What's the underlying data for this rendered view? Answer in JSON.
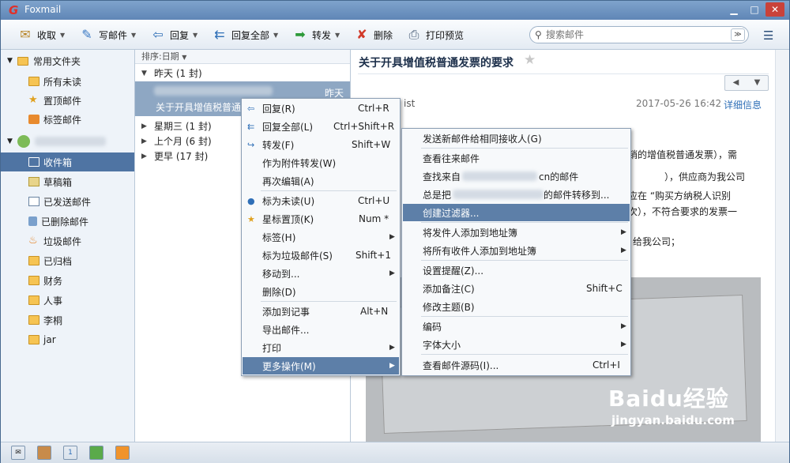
{
  "app": {
    "title": "Foxmail",
    "logo": "G"
  },
  "toolbar": {
    "receive": "收取",
    "compose": "写邮件",
    "reply": "回复",
    "reply_all": "回复全部",
    "forward": "转发",
    "delete": "删除",
    "print_preview": "打印预览",
    "search_placeholder": "搜索邮件"
  },
  "sidebar": {
    "group1": "常用文件夹",
    "fav": [
      "所有未读",
      "置顶邮件",
      "标签邮件"
    ],
    "account_folders": [
      "收件箱",
      "草稿箱",
      "已发送邮件",
      "已删除邮件",
      "垃圾邮件",
      "已归档",
      "财务",
      "人事",
      "李桐",
      "jar"
    ]
  },
  "list": {
    "sort": "排序:日期",
    "groups": [
      "昨天 (1 封)",
      "星期三 (1 封)",
      "上个月 (6 封)",
      "更早 (17 封)"
    ],
    "msg_time": "昨天",
    "msg_subject": "关于开具增值税普通发"
  },
  "reader": {
    "subject": "关于开具增值税普通发票的要求",
    "sender_fragment": "ist",
    "date": "2017-05-26 16:42",
    "detail_link": "详细信息",
    "body_lines": [
      "销的增值税普通发票），需",
      "），供应商为我公司",
      "应在 “购买方纳税人识别",
      "次），不符合要求的发票一",
      "给我公司；"
    ]
  },
  "context_menu": [
    {
      "label": "回复(R)",
      "shortcut": "Ctrl+R",
      "icon": "reply-icon"
    },
    {
      "label": "回复全部(L)",
      "shortcut": "Ctrl+Shift+R",
      "icon": "reply-all-icon"
    },
    {
      "label": "转发(F)",
      "shortcut": "Shift+W",
      "icon": "forward-icon"
    },
    {
      "label": "作为附件转发(W)",
      "shortcut": ""
    },
    {
      "label": "再次编辑(A)",
      "shortcut": ""
    },
    {
      "label": "标为未读(U)",
      "shortcut": "Ctrl+U",
      "icon": "unread-dot-icon"
    },
    {
      "label": "星标置顶(K)",
      "shortcut": "Num *",
      "icon": "star-icon"
    },
    {
      "label": "标签(H)",
      "shortcut": ""
    },
    {
      "label": "标为垃圾邮件(S)",
      "shortcut": "Shift+1"
    },
    {
      "label": "移动到...",
      "shortcut": ""
    },
    {
      "label": "删除(D)",
      "shortcut": ""
    },
    {
      "label": "添加到记事",
      "shortcut": "Alt+N"
    },
    {
      "label": "导出邮件...",
      "shortcut": ""
    },
    {
      "label": "打印",
      "shortcut": ""
    },
    {
      "label": "更多操作(M)",
      "shortcut": ""
    }
  ],
  "submenu": [
    {
      "label": "发送新邮件给相同接收人(G)",
      "shortcut": ""
    },
    {
      "label": "查看往来邮件",
      "shortcut": ""
    },
    {
      "label": "查找来自",
      "suffix": "cn的邮件",
      "shortcut": ""
    },
    {
      "label": "总是把",
      "suffix": "的邮件转移到...",
      "shortcut": ""
    },
    {
      "label": "创建过滤器...",
      "shortcut": ""
    },
    {
      "label": "将发件人添加到地址簿",
      "shortcut": ""
    },
    {
      "label": "将所有收件人添加到地址簿",
      "shortcut": ""
    },
    {
      "label": "设置提醒(Z)...",
      "shortcut": ""
    },
    {
      "label": "添加备注(C)",
      "shortcut": "Shift+C"
    },
    {
      "label": "修改主题(B)",
      "shortcut": ""
    },
    {
      "label": "编码",
      "shortcut": ""
    },
    {
      "label": "字体大小",
      "shortcut": ""
    },
    {
      "label": "查看邮件源码(I)...",
      "shortcut": "Ctrl+I"
    }
  ],
  "watermark": {
    "brand": "Baidu经验",
    "url": "jingyan.baidu.com"
  }
}
